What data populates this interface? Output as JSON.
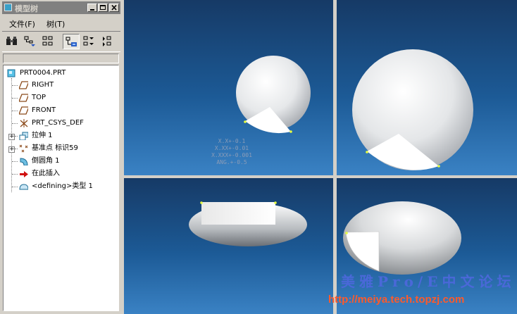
{
  "window": {
    "title": "模型树"
  },
  "menu": [
    {
      "label": "文件(F)"
    },
    {
      "label": "树(T)"
    }
  ],
  "toolbar": {
    "buttons": [
      {
        "icon": "binoculars-icon"
      },
      {
        "icon": "tree-filter-icon"
      },
      {
        "icon": "tree-columns-icon"
      },
      {
        "icon": "tree-layer-icon",
        "active": true
      },
      {
        "icon": "expand-all-icon"
      },
      {
        "icon": "collapse-all-icon"
      }
    ]
  },
  "tree": {
    "root": {
      "label": "PRT0004.PRT",
      "icon": "part-icon"
    },
    "items": [
      {
        "label": "RIGHT",
        "icon": "datum-plane-icon"
      },
      {
        "label": "TOP",
        "icon": "datum-plane-icon"
      },
      {
        "label": "FRONT",
        "icon": "datum-plane-icon"
      },
      {
        "label": "PRT_CSYS_DEF",
        "icon": "csys-icon"
      },
      {
        "label": "拉伸 1",
        "icon": "extrude-icon",
        "expandable": true
      },
      {
        "label": "基准点 标识59",
        "icon": "datum-point-icon",
        "expandable": true
      },
      {
        "label": "倒圆角 1",
        "icon": "round-icon"
      },
      {
        "label": "在此插入",
        "icon": "insert-here-icon"
      },
      {
        "label": "<defining>类型 1",
        "icon": "defining-feature-icon"
      }
    ]
  },
  "viewport": {
    "tolerances": [
      "X.X+-0.1",
      "X.XX+-0.01",
      "X.XXX+-0.001",
      "ANG.+-0.5"
    ]
  },
  "watermark": {
    "title": "美雅Pro/E中文论坛",
    "url": "http://meiya.tech.topzj.com"
  },
  "colors": {
    "titlebar": "#808080",
    "viewport_top": "#163a66",
    "viewport_bottom": "#3a82c4",
    "watermark_title": "#4a68d8",
    "watermark_url": "#ff5a2a"
  }
}
